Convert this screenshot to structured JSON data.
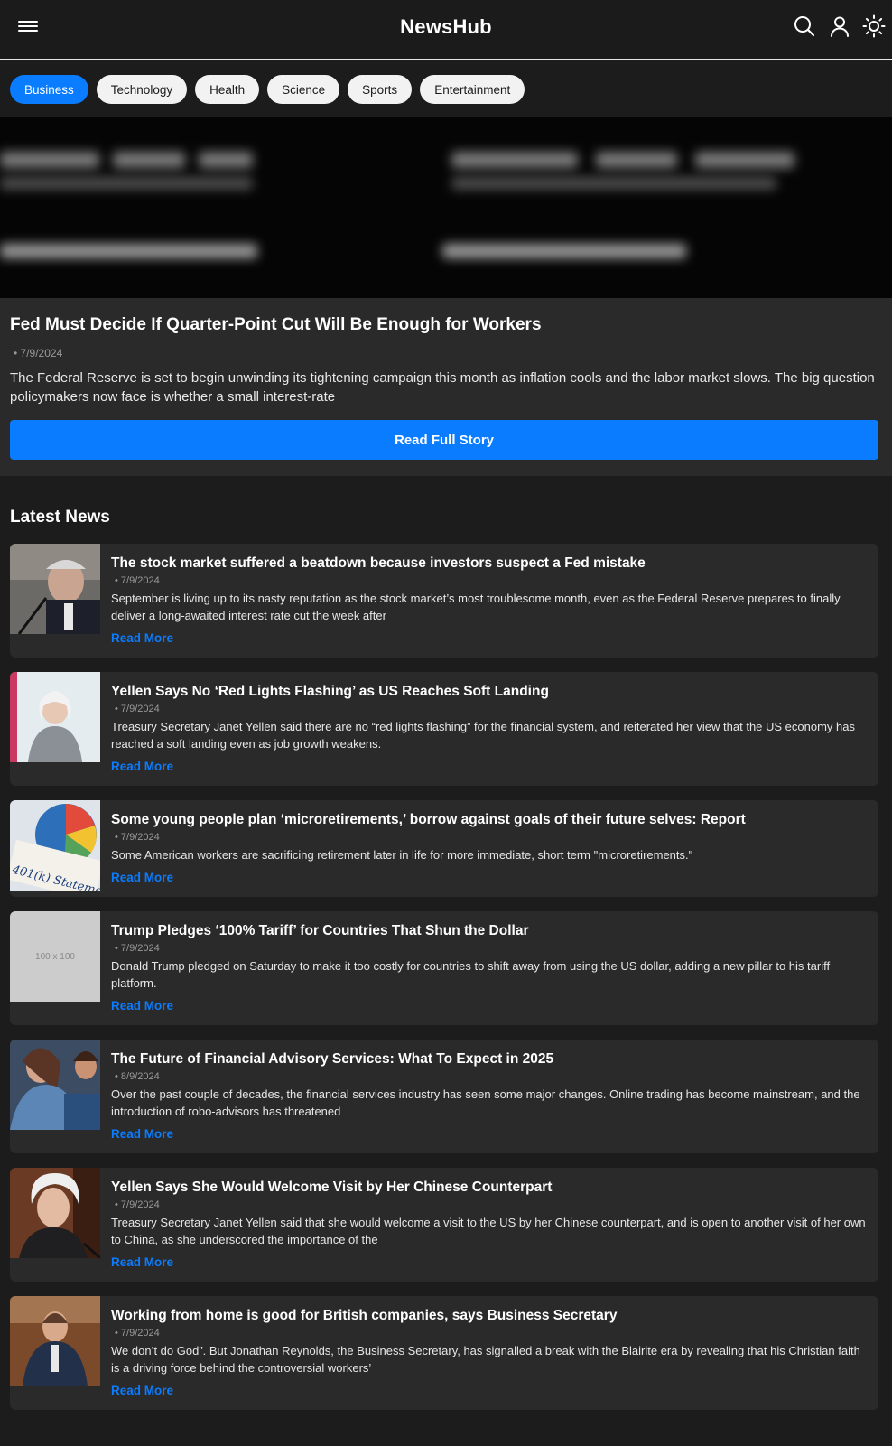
{
  "header": {
    "title": "NewsHub"
  },
  "icons": {
    "menu": "menu-icon",
    "search": "search-icon",
    "user": "user-icon",
    "theme": "sun-icon"
  },
  "colors": {
    "accent": "#0a7cff",
    "background": "#1c1c1c",
    "card": "#2a2a2a"
  },
  "categories": [
    "Business",
    "Technology",
    "Health",
    "Science",
    "Sports",
    "Entertainment"
  ],
  "active_category": "Business",
  "featured": {
    "title": "Fed Must Decide If Quarter-Point Cut Will Be Enough for Workers",
    "date": "• 7/9/2024",
    "description": "The Federal Reserve is set to begin unwinding its tightening campaign this month as inflation cools and the labor market slows. The big question policymakers now face is whether a small interest-rate",
    "button_label": "Read Full Story"
  },
  "latest": {
    "heading": "Latest News",
    "read_more_label": "Read More",
    "articles": [
      {
        "title": "The stock market suffered a beatdown because investors suspect a Fed mistake",
        "date": "• 7/9/2024",
        "description": "September is living up to its nasty reputation as the stock market’s most troublesome month, even as the Federal Reserve prepares to finally deliver a long-awaited interest rate cut the week after"
      },
      {
        "title": "Yellen Says No ‘Red Lights Flashing’ as US Reaches Soft Landing",
        "date": "• 7/9/2024",
        "description": "Treasury Secretary Janet Yellen said there are no “red lights flashing” for the financial system, and reiterated her view that the US economy has reached a soft landing even as job growth weakens."
      },
      {
        "title": "Some young people plan ‘microretirements,’ borrow against goals of their future selves: Report",
        "date": "• 7/9/2024",
        "description": "Some American workers are sacrificing retirement later in life for more immediate, short term \"microretirements.\""
      },
      {
        "title": "Trump Pledges ‘100% Tariff’ for Countries That Shun the Dollar",
        "date": "• 7/9/2024",
        "description": "Donald Trump pledged on Saturday to make it too costly for countries to shift away from using the US dollar, adding a new pillar to his tariff platform.",
        "placeholder": "100 x 100"
      },
      {
        "title": "The Future of Financial Advisory Services: What To Expect in 2025",
        "date": "• 8/9/2024",
        "description": "Over the past couple of decades, the financial services industry has seen some major changes. Online trading has become mainstream, and the introduction of robo-advisors has threatened"
      },
      {
        "title": "Yellen Says She Would Welcome Visit by Her Chinese Counterpart",
        "date": "• 7/9/2024",
        "description": "Treasury Secretary Janet Yellen said that she would welcome a visit to the US by her Chinese counterpart, and is open to another visit of her own to China, as she underscored the importance of the"
      },
      {
        "title": "Working from home is good for British companies, says Business Secretary",
        "date": "• 7/9/2024",
        "description": "We don’t do God”. But Jonathan Reynolds, the Business Secretary, has signalled a break with the Blairite era by revealing that his Christian faith is a driving force behind the controversial workers’"
      }
    ]
  }
}
